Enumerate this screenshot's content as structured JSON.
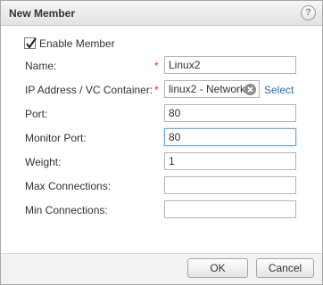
{
  "dialog": {
    "title": "New Member",
    "help_icon": "?"
  },
  "form": {
    "enable_member": {
      "label": "Enable Member",
      "checked": true
    },
    "name": {
      "label": "Name:",
      "value": "Linux2",
      "required_marker": "*"
    },
    "ip_container": {
      "label": "IP Address / VC Container:",
      "value": "linux2 - Network",
      "required_marker": "*",
      "select_label": "Select"
    },
    "port": {
      "label": "Port:",
      "value": "80"
    },
    "monitor_port": {
      "label": "Monitor Port:",
      "value": "80"
    },
    "weight": {
      "label": "Weight:",
      "value": "1"
    },
    "max_connections": {
      "label": "Max Connections:",
      "value": ""
    },
    "min_connections": {
      "label": "Min Connections:",
      "value": ""
    }
  },
  "footer": {
    "ok_label": "OK",
    "cancel_label": "Cancel"
  },
  "colors": {
    "required": "#d9362b",
    "link": "#2d6bb0",
    "focus_border": "#6fa6d6"
  },
  "icons": {
    "help": "help-icon",
    "checkbox": "checkmark-icon",
    "clear": "clear-icon"
  }
}
